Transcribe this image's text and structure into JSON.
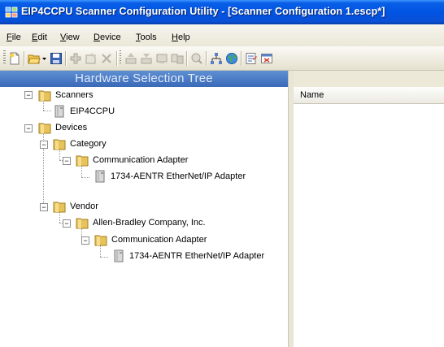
{
  "window": {
    "title": "EIP4CCPU Scanner Configuration Utility - [Scanner Configuration 1.escp*]"
  },
  "menu": [
    {
      "label": "File",
      "key": "F",
      "rest": "ile"
    },
    {
      "label": "Edit",
      "key": "E",
      "rest": "dit"
    },
    {
      "label": "View",
      "key": "V",
      "rest": "iew"
    },
    {
      "label": "Device",
      "key": "D",
      "rest": "evice"
    },
    {
      "label": "Tools",
      "key": "T",
      "rest": "ools"
    },
    {
      "label": "Help",
      "key": "H",
      "rest": "elp"
    }
  ],
  "toolbar": {
    "buttons": [
      "new-icon",
      "open-folder-icon",
      "dropdown-arrow-icon",
      "save-icon",
      "add-device-icon",
      "properties-icon",
      "delete-icon",
      "upload-icon",
      "download-icon",
      "online-icon",
      "compare-icon",
      "browse-icon",
      "network-icon",
      "globe-icon",
      "report-icon",
      "close-report-icon"
    ]
  },
  "left_pane": {
    "header": "Hardware Selection Tree",
    "tree": {
      "scanners": "Scanners",
      "eip4ccpu": "EIP4CCPU",
      "devices": "Devices",
      "category": "Category",
      "comm_adapter_1": "Communication Adapter",
      "aentr_1": "1734-AENTR EtherNet/IP Adapter",
      "vendor": "Vendor",
      "allen_bradley": "Allen-Bradley Company, Inc.",
      "comm_adapter_2": "Communication Adapter",
      "aentr_2": "1734-AENTR EtherNet/IP Adapter"
    }
  },
  "right_pane": {
    "columns": [
      "Name"
    ]
  },
  "colors": {
    "titlebar": "#0054e3",
    "pane_header": "#3a6ab8",
    "folder": "#e8c25a",
    "chrome": "#ece9d8"
  }
}
